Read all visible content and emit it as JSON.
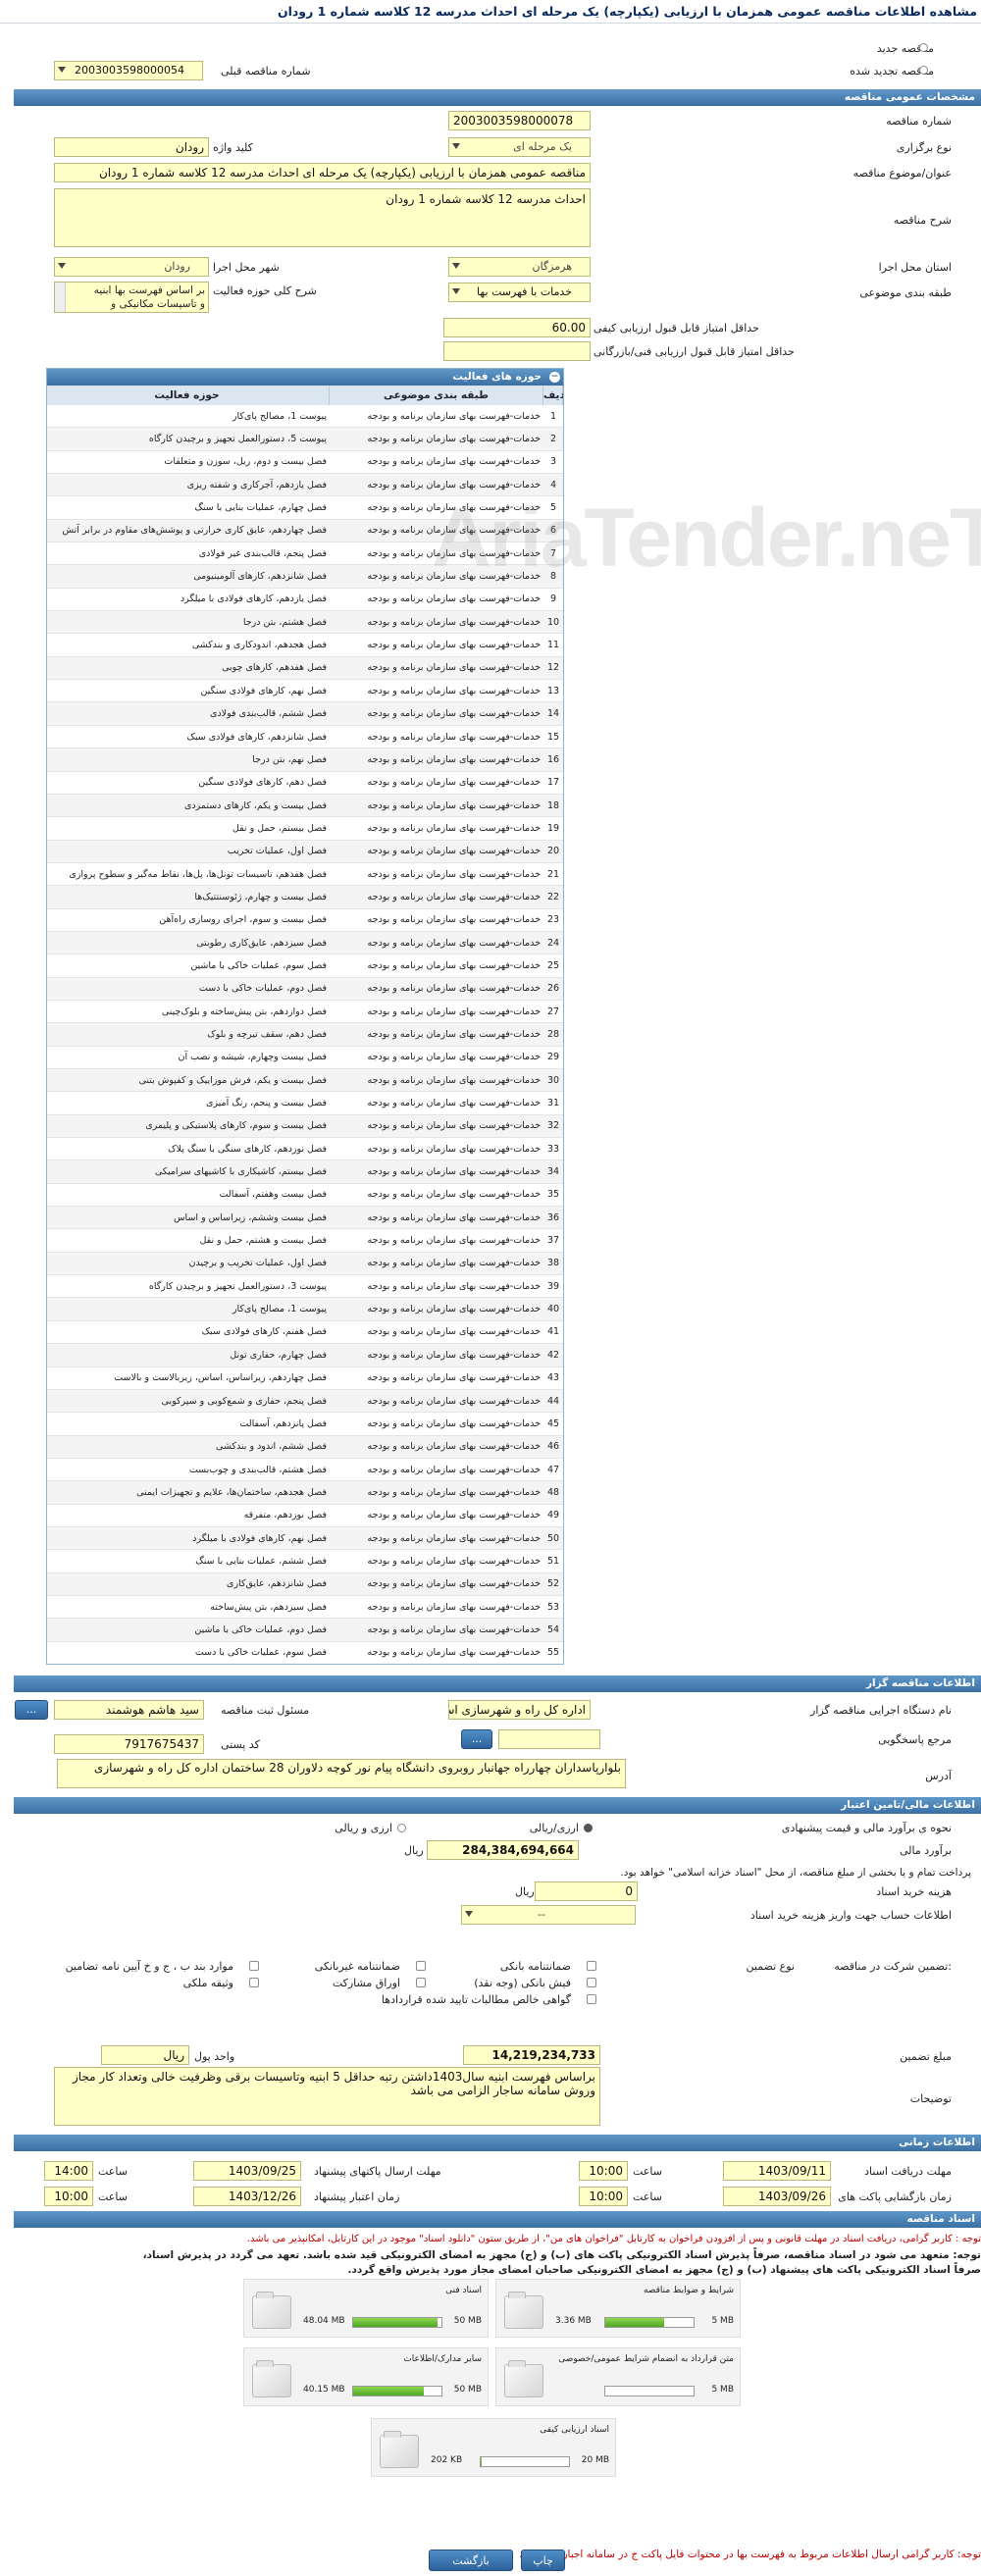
{
  "page_title": "مشاهده اطلاعات مناقصه عمومی همزمان با ارزیابی (یکپارچه) یک مرحله ای احداث مدرسه 12 کلاسه شماره 1 رودان",
  "top_radios": {
    "new": "مناقصه جدید",
    "renewed": "مناقصه تجدید شده"
  },
  "prev_tender": {
    "label": "شماره مناقصه قبلی",
    "value": "2003003598000054"
  },
  "sections": {
    "general": "مشخصات عمومی مناقصه",
    "organizer": "اطلاعات مناقصه گزار",
    "financial": "اطلاعات مالی/تامین اعتبار",
    "timing": "اطلاعات زمانی",
    "documents": "اسناد مناقصه"
  },
  "general": {
    "tender_no_label": "شماره مناقصه",
    "tender_no": "2003003598000078",
    "type_label": "نوع برگزاری",
    "type": "یک مرحله ای",
    "keyword_label": "کلید واژه",
    "keyword": "رودان",
    "subject_label": "عنوان/موضوع مناقصه",
    "subject": "مناقصه عمومی همزمان با ارزیابی (یکپارچه) یک مرحله ای احداث مدرسه 12 کلاسه شماره 1 رودان",
    "desc_label": "شرح مناقصه",
    "desc": "احداث مدرسه 12 کلاسه شماره 1 رودان",
    "province_label": "استان محل اجرا",
    "province": "هرمزگان",
    "city_label": "شهر محل اجرا",
    "city": "رودان",
    "category_label": "طبقه بندی موضوعی",
    "category": "خدمات با فهرست بها",
    "scope_label": "شرح کلی حوزه فعالیت",
    "scope_line1": "بر اساس فهرست بها ابنیه",
    "scope_line2": "و تاسیسات مکانیکی و",
    "min_score_label": "حداقل امتیاز قابل قبول ارزیابی کیفی",
    "min_score": "60.00",
    "min_tech_label": "حداقل امتیاز قابل قبول ارزیابی فنی/بازرگانی",
    "min_tech": ""
  },
  "activity_table": {
    "title": "حوزه های فعالیت",
    "col_row": "ردیف",
    "col_class": "طبقه بندی موضوعی",
    "col_field": "حوزه فعالیت",
    "rows": [
      [
        "1",
        "خدمات-فهرست بهای سازمان برنامه و بودجه",
        "پیوست 1، مصالح پای‌کار"
      ],
      [
        "2",
        "خدمات-فهرست بهای سازمان برنامه و بودجه",
        "پیوست 5، دستورالعمل تجهیز و برچیدن کارگاه"
      ],
      [
        "3",
        "خدمات-فهرست بهای سازمان برنامه و بودجه",
        "فصل بیست و دوم، ریل، سوزن و متعلقات"
      ],
      [
        "4",
        "خدمات-فهرست بهای سازمان برنامه و بودجه",
        "فصل یازدهم، آجرکاری و شفته ریزی"
      ],
      [
        "5",
        "خدمات-فهرست بهای سازمان برنامه و بودجه",
        "فصل چهارم، عملیات بنایی با سنگ"
      ],
      [
        "6",
        "خدمات-فهرست بهای سازمان برنامه و بودجه",
        "فصل چهاردهم، عایق کاری حرارتی و پوشش‌های مقاوم در برابر آتش"
      ],
      [
        "7",
        "خدمات-فهرست بهای سازمان برنامه و بودجه",
        "فصل پنجم، قالب‌بندی غیر فولادی"
      ],
      [
        "8",
        "خدمات-فهرست بهای سازمان برنامه و بودجه",
        "فصل شانزدهم، کارهای آلومینیومی"
      ],
      [
        "9",
        "خدمات-فهرست بهای سازمان برنامه و بودجه",
        "فصل یازدهم، کارهای فولادی با میلگرد"
      ],
      [
        "10",
        "خدمات-فهرست بهای سازمان برنامه و بودجه",
        "فصل هشتم، بتن درجا"
      ],
      [
        "11",
        "خدمات-فهرست بهای سازمان برنامه و بودجه",
        "فصل هجدهم، اندودکاری و بندکشی"
      ],
      [
        "12",
        "خدمات-فهرست بهای سازمان برنامه و بودجه",
        "فصل هفدهم، کارهای چوبی"
      ],
      [
        "13",
        "خدمات-فهرست بهای سازمان برنامه و بودجه",
        "فصل نهم، کارهای فولادی سنگین"
      ],
      [
        "14",
        "خدمات-فهرست بهای سازمان برنامه و بودجه",
        "فصل ششم، قالب‌بندی فولادی"
      ],
      [
        "15",
        "خدمات-فهرست بهای سازمان برنامه و بودجه",
        "فصل شانزدهم، کارهای فولادی سبک"
      ],
      [
        "16",
        "خدمات-فهرست بهای سازمان برنامه و بودجه",
        "فصل نهم، بتن درجا"
      ],
      [
        "17",
        "خدمات-فهرست بهای سازمان برنامه و بودجه",
        "فصل دهم، کارهای فولادی سنگین"
      ],
      [
        "18",
        "خدمات-فهرست بهای سازمان برنامه و بودجه",
        "فصل بیست و یکم، کارهای دستمزدی"
      ],
      [
        "19",
        "خدمات-فهرست بهای سازمان برنامه و بودجه",
        "فصل بیستم، حمل و نقل"
      ],
      [
        "20",
        "خدمات-فهرست بهای سازمان برنامه و بودجه",
        "فصل اول، عملیات تخریب"
      ],
      [
        "21",
        "خدمات-فهرست بهای سازمان برنامه و بودجه",
        "فصل هفدهم، تاسیسات تونل‌ها، پل‌ها، نقاط مه‌گیر و سطوح پروازی"
      ],
      [
        "22",
        "خدمات-فهرست بهای سازمان برنامه و بودجه",
        "فصل بیست و چهارم، ژئوسنتتیک‌ها"
      ],
      [
        "23",
        "خدمات-فهرست بهای سازمان برنامه و بودجه",
        "فصل بیست و سوم، اجرای روسازی راه‌آهن"
      ],
      [
        "24",
        "خدمات-فهرست بهای سازمان برنامه و بودجه",
        "فصل سیزدهم، عایق‌کاری رطوبتی"
      ],
      [
        "25",
        "خدمات-فهرست بهای سازمان برنامه و بودجه",
        "فصل سوم، عملیات خاکی با ماشین"
      ],
      [
        "26",
        "خدمات-فهرست بهای سازمان برنامه و بودجه",
        "فصل دوم، عملیات خاکی با دست"
      ],
      [
        "27",
        "خدمات-فهرست بهای سازمان برنامه و بودجه",
        "فصل دوازدهم، بتن پیش‌ساخته و بلوک‌چینی"
      ],
      [
        "28",
        "خدمات-فهرست بهای سازمان برنامه و بودجه",
        "فصل دهم، سقف تیرچه و بلوک"
      ],
      [
        "29",
        "خدمات-فهرست بهای سازمان برنامه و بودجه",
        "فصل بیست وچهارم، شیشه و نصب آن"
      ],
      [
        "30",
        "خدمات-فهرست بهای سازمان برنامه و بودجه",
        "فصل بیست و یکم، فرش موزاییک و کفپوش بتنی"
      ],
      [
        "31",
        "خدمات-فهرست بهای سازمان برنامه و بودجه",
        "فصل بیست و پنجم، رنگ آمیزی"
      ],
      [
        "32",
        "خدمات-فهرست بهای سازمان برنامه و بودجه",
        "فصل بیست و سوم، کارهای پلاستیکی و پلیمری"
      ],
      [
        "33",
        "خدمات-فهرست بهای سازمان برنامه و بودجه",
        "فصل نوزدهم، کارهای سنگی با سنگ پلاک"
      ],
      [
        "34",
        "خدمات-فهرست بهای سازمان برنامه و بودجه",
        "فصل بیستم، کاشیکاری با کاشیهای سرامیکی"
      ],
      [
        "35",
        "خدمات-فهرست بهای سازمان برنامه و بودجه",
        "فصل بیست وهفتم، آسفالت"
      ],
      [
        "36",
        "خدمات-فهرست بهای سازمان برنامه و بودجه",
        "فصل بیست وششم، زیراساس و اساس"
      ],
      [
        "37",
        "خدمات-فهرست بهای سازمان برنامه و بودجه",
        "فصل بیست و هشتم، حمل و نقل"
      ],
      [
        "38",
        "خدمات-فهرست بهای سازمان برنامه و بودجه",
        "فصل اول، عملیات تخریب و برچیدن"
      ],
      [
        "39",
        "خدمات-فهرست بهای سازمان برنامه و بودجه",
        "پیوست 3، دستورالعمل تجهیز و برچیدن کارگاه"
      ],
      [
        "40",
        "خدمات-فهرست بهای سازمان برنامه و بودجه",
        "پیوست 1، مصالح پای‌کار"
      ],
      [
        "41",
        "خدمات-فهرست بهای سازمان برنامه و بودجه",
        "فصل هفتم، کارهای فولادی سبک"
      ],
      [
        "42",
        "خدمات-فهرست بهای سازمان برنامه و بودجه",
        "فصل چهارم، حفاری تونل"
      ],
      [
        "43",
        "خدمات-فهرست بهای سازمان برنامه و بودجه",
        "فصل چهاردهم، زیراساس، اساس، زیربالاست و بالاست"
      ],
      [
        "44",
        "خدمات-فهرست بهای سازمان برنامه و بودجه",
        "فصل پنجم، حفاری و شمع‌کوبی و سپرکوبی"
      ],
      [
        "45",
        "خدمات-فهرست بهای سازمان برنامه و بودجه",
        "فصل پانزدهم، آسفالت"
      ],
      [
        "46",
        "خدمات-فهرست بهای سازمان برنامه و بودجه",
        "فصل ششم، اندود و بندکشی"
      ],
      [
        "47",
        "خدمات-فهرست بهای سازمان برنامه و بودجه",
        "فصل هشتم، قالب‌بندی و چوب‌بست"
      ],
      [
        "48",
        "خدمات-فهرست بهای سازمان برنامه و بودجه",
        "فصل هجدهم، ساختمان‌ها، علایم و تجهیزات ایمنی"
      ],
      [
        "49",
        "خدمات-فهرست بهای سازمان برنامه و بودجه",
        "فصل نوزدهم، متفرقه"
      ],
      [
        "50",
        "خدمات-فهرست بهای سازمان برنامه و بودجه",
        "فصل نهم، کارهای فولادی با میلگرد"
      ],
      [
        "51",
        "خدمات-فهرست بهای سازمان برنامه و بودجه",
        "فصل ششم، عملیات بنایی با سنگ"
      ],
      [
        "52",
        "خدمات-فهرست بهای سازمان برنامه و بودجه",
        "فصل شانزدهم، عایق‌کاری"
      ],
      [
        "53",
        "خدمات-فهرست بهای سازمان برنامه و بودجه",
        "فصل سیزدهم، بتن پیش‌ساخته"
      ],
      [
        "54",
        "خدمات-فهرست بهای سازمان برنامه و بودجه",
        "فصل دوم، عملیات خاکی با ماشین"
      ],
      [
        "55",
        "خدمات-فهرست بهای سازمان برنامه و بودجه",
        "فصل سوم، عملیات خاکی با دست"
      ]
    ]
  },
  "organizer": {
    "org_label": "نام دستگاه اجرایی مناقصه گزار",
    "org": "اداره کل راه و شهرسازی استان هرمزگان",
    "resp_label": "مسئول ثبت مناقصه",
    "resp": "سید هاشم هوشمند",
    "ref_label": "مرجع پاسخگویی",
    "ref": "",
    "postal_label": "کد پستی",
    "postal": "7917675437",
    "address_label": "آدرس",
    "address": "بلوارپاسداران چهارراه جهانبار روبروی دانشگاه پیام نور کوچه دلاوران 28 ساختمان اداره کل راه و شهرسازی",
    "btn_more": "..."
  },
  "financial": {
    "method_label": "نحوه ی برآورد مالی و قیمت پیشنهادی",
    "opt_rial": "ارزی/ریالی",
    "opt_fx": "ارزی و ریالی",
    "estimate_label": "برآورد مالی",
    "estimate": "284,384,694,664",
    "currency": "ریال",
    "treasury_note": "پرداخت تمام و یا بخشی از مبلغ مناقصه، از محل \"اسناد خزانه اسلامی\" خواهد بود.",
    "doc_cost_label": "هزینه خرید اسناد",
    "doc_cost": "0",
    "doc_cost_unit": "ریال",
    "account_label": "اطلاعات حساب جهت واریز هزینه خرید اسناد",
    "account": "--",
    "guarantee_title": "تضمین شرکت در مناقصه:",
    "guarantee_type_label": "نوع تضمین",
    "g_bank": "ضمانتنامه بانکی",
    "g_nonbank": "ضمانتنامه غیربانکی",
    "g_items": "موارد بند ب ، ج و خ آیین نامه تضامین",
    "g_cheque": "فیش بانکی (وجه نقد)",
    "g_bonds": "اوراق مشارکت",
    "g_property": "وثیقه ملکی",
    "g_receivable": "گواهی خالص مطالبات تایید شده قراردادها",
    "amount_label": "مبلغ تضمین",
    "amount": "14,219,234,733",
    "unit_label": "واحد پول",
    "unit": "ریال",
    "desc_label": "توضیحات",
    "desc": "براساس فهرست ابنیه سال1403داشتن رتبه حداقل 5 ابنیه وتاسیسات برقی وظرفیت خالی وتعداد کار مجاز وروش سامانه ساجار الزامی می باشد"
  },
  "timing": {
    "receive_label": "مهلت دریافت اسناد",
    "receive_date": "1403/09/11",
    "receive_time": "10:00",
    "submit_label": "مهلت ارسال پاکتهای پیشنهاد",
    "submit_date": "1403/09/25",
    "submit_time": "14:00",
    "open_label": "زمان بازگشایی پاکت های",
    "open_date": "1403/09/26",
    "open_time": "10:00",
    "valid_label": "زمان اعتبار پیشنهاد",
    "valid_date": "1403/12/26",
    "valid_time": "10:00",
    "time_word": "ساعت"
  },
  "documents": {
    "note1": "توجه : کاربر گرامی، دریافت اسناد در مهلت قانونی و پس از افزودن فراخوان به کارتابل \"فراخوان های من\"، از طریق ستون \"دانلود اسناد\" موجود در این کارتابل، امکانپذیر می باشد.",
    "note2": "توجه: متعهد می شود در اسناد مناقصه، صرفاً پذیرش اسناد الکترونیکی پاکت های (ب) و (ج) مجهز به امضای الکترونیکی قید شده باشد. تعهد می گردد در پذیرش اسناد،",
    "note3": "صرفاً اسناد الکترونیکی پاکت های پیشنهاد (ب) و (ج) مجهز به امضای الکترونیکی صاحبان امضای مجاز مورد پذیرش واقع گردد.",
    "files": [
      {
        "name": "شرایط و ضوابط مناقصه",
        "size": "3.36 MB",
        "max": "5 MB",
        "pct": 67
      },
      {
        "name": "اسناد فنی",
        "size": "48.04 MB",
        "max": "50 MB",
        "pct": 96
      },
      {
        "name": "متن قرارداد به انضمام شرایط عمومی/خصوصی",
        "size": "",
        "max": "5 MB",
        "pct": 0
      },
      {
        "name": "سایر مدارک/اطلاعات",
        "size": "40.15 MB",
        "max": "50 MB",
        "pct": 80
      },
      {
        "name": "اسناد ارزیابی کیفی",
        "size": "202 KB",
        "max": "20 MB",
        "pct": 1
      }
    ],
    "footer_note": "توجه: کاربر گرامی ارسال اطلاعات مربوط به فهرست بها در محتوات فایل پاکت ج در سامانه اجباری میباشد."
  },
  "actions": {
    "back": "بازگشت",
    "print": "چاپ"
  },
  "watermark": "AriaTender.neT",
  "colors": {
    "accent": "#3a6fa3",
    "input_bg": "#ffffc8",
    "note_red": "#c00000"
  }
}
